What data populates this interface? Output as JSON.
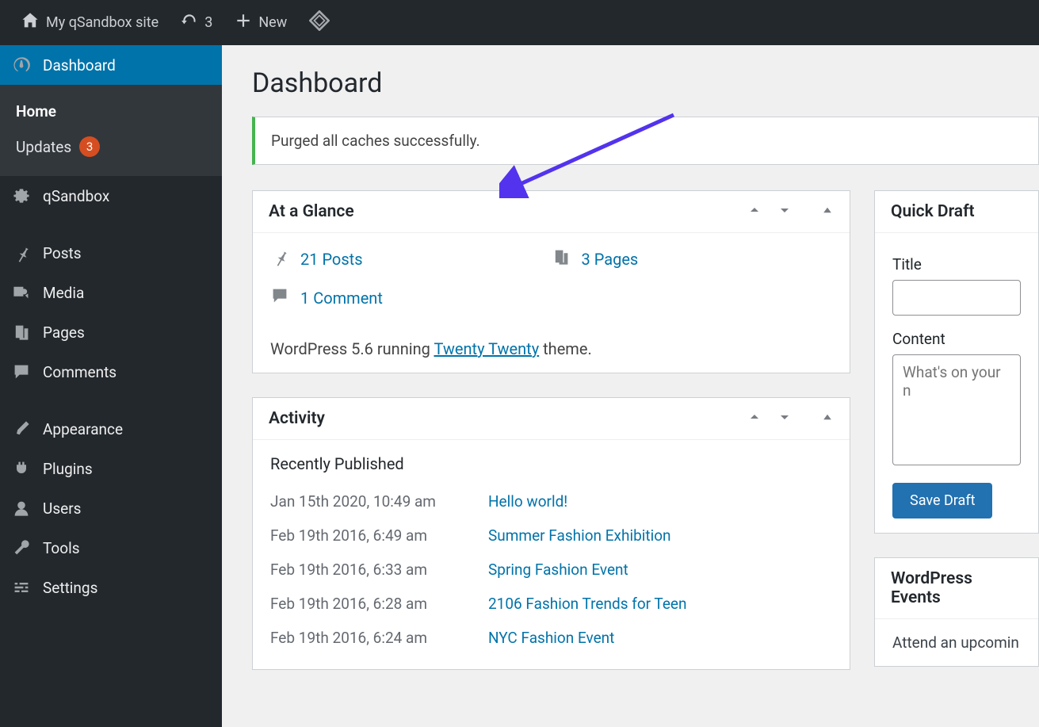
{
  "topbar": {
    "site_name": "My qSandbox site",
    "refresh_count": "3",
    "new_label": "New"
  },
  "sidebar": {
    "dashboard": "Dashboard",
    "home": "Home",
    "updates": "Updates",
    "updates_count": "3",
    "qsandbox": "qSandbox",
    "posts": "Posts",
    "media": "Media",
    "pages": "Pages",
    "comments": "Comments",
    "appearance": "Appearance",
    "plugins": "Plugins",
    "users": "Users",
    "tools": "Tools",
    "settings": "Settings"
  },
  "page_title": "Dashboard",
  "notice_text": "Purged all caches successfully.",
  "glance": {
    "title": "At a Glance",
    "posts": "21 Posts",
    "pages": "3 Pages",
    "comment": "1 Comment",
    "wp_pre": "WordPress 5.6 running ",
    "wp_theme": "Twenty Twenty",
    "wp_post": " theme."
  },
  "activity": {
    "title": "Activity",
    "subtitle": "Recently Published",
    "rows": [
      {
        "date": "Jan 15th 2020, 10:49 am",
        "link": "Hello world!"
      },
      {
        "date": "Feb 19th 2016, 6:49 am",
        "link": "Summer Fashion Exhibition"
      },
      {
        "date": "Feb 19th 2016, 6:33 am",
        "link": "Spring Fashion Event"
      },
      {
        "date": "Feb 19th 2016, 6:28 am",
        "link": "2106 Fashion Trends for Teen"
      },
      {
        "date": "Feb 19th 2016, 6:24 am",
        "link": "NYC Fashion Event"
      }
    ]
  },
  "draft": {
    "title": "Quick Draft",
    "title_label": "Title",
    "content_label": "Content",
    "content_placeholder": "What's on your n",
    "save": "Save Draft"
  },
  "events": {
    "title": "WordPress Events",
    "text": "Attend an upcomin"
  }
}
